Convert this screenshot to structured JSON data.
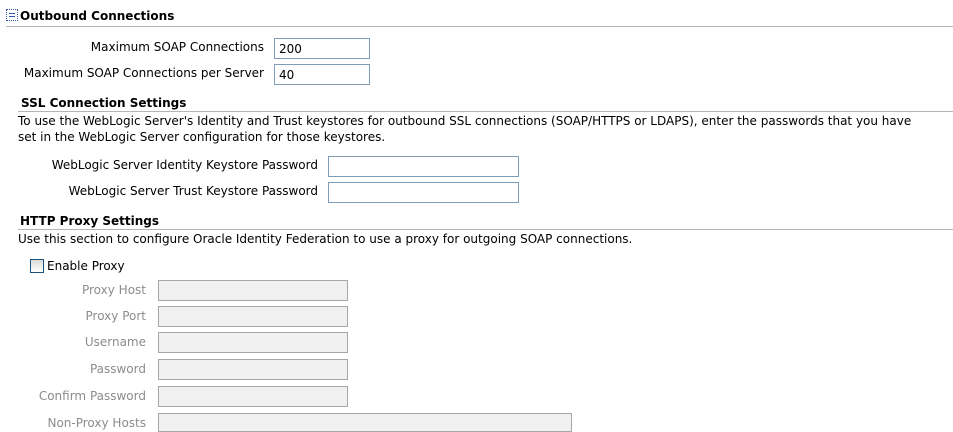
{
  "outbound": {
    "title": "Outbound Connections",
    "max_soap_label": "Maximum SOAP Connections",
    "max_soap_value": "200",
    "max_soap_per_server_label": "Maximum SOAP Connections per Server",
    "max_soap_per_server_value": "40"
  },
  "ssl": {
    "title": "SSL Connection Settings",
    "description_line1": "To use the WebLogic Server's Identity and Trust keystores for outbound SSL connections (SOAP/HTTPS or LDAPS), enter the passwords that you have",
    "description_line2": "set in the WebLogic Server configuration for those keystores.",
    "identity_label": "WebLogic Server Identity Keystore Password",
    "identity_value": "",
    "trust_label": "WebLogic Server Trust Keystore Password",
    "trust_value": ""
  },
  "proxy": {
    "title": "HTTP Proxy Settings",
    "description": "Use this section to configure Oracle Identity Federation to use a proxy for outgoing SOAP connections.",
    "enable_label": "Enable Proxy",
    "enable_checked": false,
    "host_label": "Proxy Host",
    "port_label": "Proxy Port",
    "username_label": "Username",
    "password_label": "Password",
    "confirm_password_label": "Confirm Password",
    "non_proxy_hosts_label": "Non-Proxy Hosts"
  }
}
